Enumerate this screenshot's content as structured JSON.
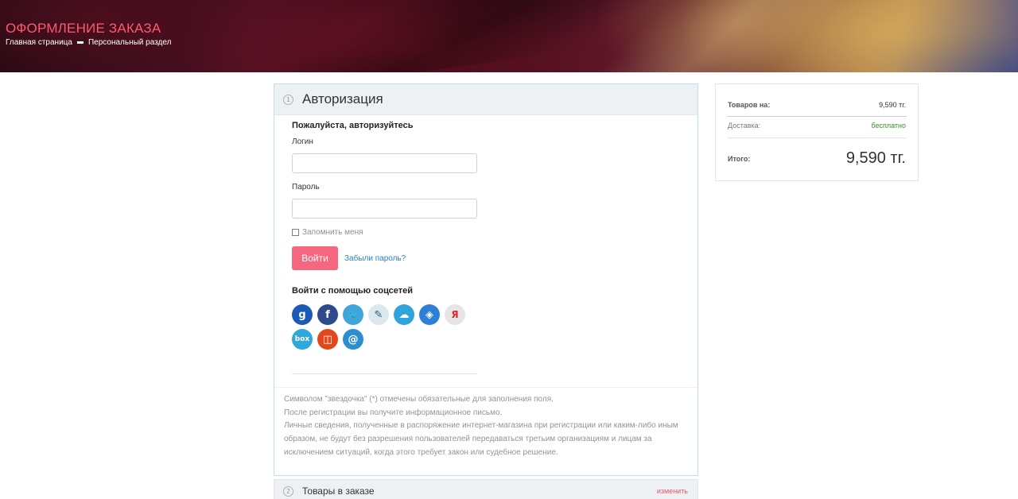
{
  "header": {
    "title": "ОФОРМЛЕНИЕ ЗАКАЗА",
    "breadcrumb": [
      "Главная страница",
      "Персональный раздел"
    ]
  },
  "auth": {
    "step_number": "1",
    "title": "Авторизация",
    "subtitle": "Пожалуйста, авторизуйтесь",
    "login_label": "Логин",
    "login_value": "",
    "password_label": "Пароль",
    "password_value": "",
    "remember_label": "Запомнить меня",
    "remember_checked": false,
    "login_button": "Войти",
    "forgot_link": "Забыли пароль?",
    "social_title": "Войти с помощью соцсетей",
    "social_row1": [
      {
        "name": "google-icon",
        "glyph": "g",
        "color": "#1a5bb8"
      },
      {
        "name": "facebook-icon",
        "glyph": "f",
        "color": "#2d4a8a"
      },
      {
        "name": "twitter-icon",
        "glyph": "🐦",
        "color": "#3ea6dc"
      },
      {
        "name": "livejournal-icon",
        "glyph": "✎",
        "color": "#dde7ee"
      },
      {
        "name": "odnoklassniki-icon",
        "glyph": "☁",
        "color": "#2fa4dc"
      },
      {
        "name": "dropbox-icon",
        "glyph": "◈",
        "color": "#2f7fd8"
      },
      {
        "name": "yandex-icon",
        "glyph": "Я",
        "color": "#e6e6e6"
      }
    ],
    "social_row2": [
      {
        "name": "box-icon",
        "glyph": "box",
        "color": "#2fa8dc"
      },
      {
        "name": "office-icon",
        "glyph": "◫",
        "color": "#e4471c"
      },
      {
        "name": "mailru-icon",
        "glyph": "@",
        "color": "#2a8ed0"
      }
    ],
    "notes": [
      "Символом \"звездочка\" (*) отмечены обязательные для заполнения поля.",
      "После регистрации вы получите информационное письмо.",
      "Личные сведения, полученные в распоряжение интернет-магазина при регистрации или каким-либо иным образом, не будут без разрешения пользователей передаваться третьим организациям и лицам за исключением ситуаций, когда этого требует закон или судебное решение."
    ]
  },
  "order_items": {
    "step_number": "2",
    "title": "Товары в заказе",
    "edit_link": "изменить"
  },
  "summary": {
    "goods_label": "Товаров на:",
    "goods_value": "9,590 тг.",
    "delivery_label": "Доставка:",
    "delivery_value": "бесплатно",
    "total_label": "Итого:",
    "total_value": "9,590 тг."
  },
  "colors": {
    "accent": "#f4677e",
    "title_red": "#ff5a6e",
    "link_blue": "#2a7fc8",
    "free_green": "#3a8f2b"
  }
}
